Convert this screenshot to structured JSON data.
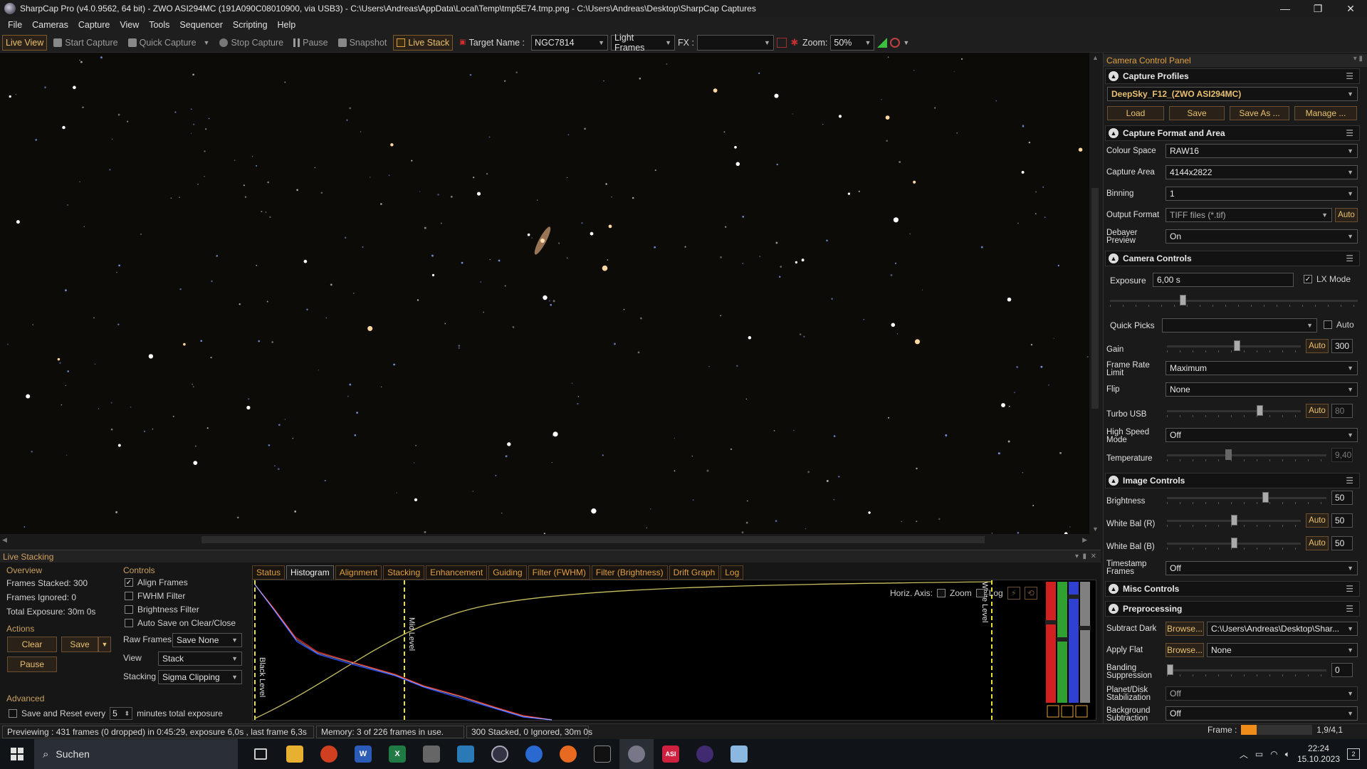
{
  "window": {
    "title": "SharpCap Pro (v4.0.9562, 64 bit) - ZWO ASI294MC (191A090C08010900, via USB3) - C:\\Users\\Andreas\\AppData\\Local\\Temp\\tmp5E74.tmp.png - C:\\Users\\Andreas\\Desktop\\SharpCap Captures",
    "min": "—",
    "max": "❐",
    "close": "✕"
  },
  "menu": [
    "File",
    "Cameras",
    "Capture",
    "View",
    "Tools",
    "Sequencer",
    "Scripting",
    "Help"
  ],
  "toolbar": {
    "live_view": "Live View",
    "start_capture": "Start Capture",
    "quick_capture": "Quick Capture",
    "stop_capture": "Stop Capture",
    "pause": "Pause",
    "snapshot": "Snapshot",
    "live_stack": "Live Stack",
    "target_label": "Target Name :",
    "target_value": "NGC7814",
    "frame_type": "Light Frames",
    "fx_label": "FX :",
    "fx_value": "",
    "zoom_label": "Zoom:",
    "zoom_value": "50%"
  },
  "live_stacking": {
    "title": "Live Stacking",
    "overview": {
      "label": "Overview",
      "frames_stacked": "Frames Stacked: 300",
      "frames_ignored": "Frames Ignored: 0",
      "total_exposure": "Total Exposure:  30m 0s"
    },
    "actions": {
      "label": "Actions",
      "clear": "Clear",
      "save": "Save",
      "pause": "Pause"
    },
    "advanced": {
      "label": "Advanced",
      "save_reset": "Save and Reset every",
      "minutes_value": "5",
      "minutes_label": "minutes total exposure"
    },
    "controls": {
      "label": "Controls",
      "align_frames": "Align Frames",
      "fwhm_filter": "FWHM Filter",
      "brightness_filter": "Brightness Filter",
      "auto_save": "Auto Save on Clear/Close",
      "raw_frames_label": "Raw Frames",
      "raw_frames_value": "Save None",
      "view_label": "View",
      "view_value": "Stack",
      "stacking_label": "Stacking",
      "stacking_value": "Sigma Clipping"
    },
    "tabs": [
      "Status",
      "Histogram",
      "Alignment",
      "Stacking",
      "Enhancement",
      "Guiding",
      "Filter (FWHM)",
      "Filter (Brightness)",
      "Drift Graph",
      "Log"
    ],
    "active_tab": "Histogram",
    "histogram": {
      "horiz_axis": "Horiz. Axis:",
      "zoom": "Zoom",
      "log": "Log",
      "black_level": "Black Level",
      "mid_level": "Mid Level",
      "white_level": "White Level"
    }
  },
  "status_bar": {
    "previewing": "Previewing : 431 frames (0 dropped) in 0:45:29, exposure 6,0s , last frame 6,3s",
    "memory": "Memory: 3 of 226 frames in use.",
    "stacked": "300 Stacked, 0 Ignored, 30m 0s",
    "frame_label": "Frame :",
    "frame_value": "1,9/4,1",
    "frame_fill_fraction": 0.22
  },
  "panel": {
    "title": "Camera Control Panel",
    "capture_profiles": {
      "header": "Capture Profiles",
      "profile": "DeepSky_F12_(ZWO ASI294MC)",
      "load": "Load",
      "save": "Save",
      "save_as": "Save As ...",
      "manage": "Manage ..."
    },
    "format": {
      "header": "Capture Format and Area",
      "colour_space_label": "Colour Space",
      "colour_space": "RAW16",
      "capture_area_label": "Capture Area",
      "capture_area": "4144x2822",
      "binning_label": "Binning",
      "binning": "1",
      "output_format_label": "Output Format",
      "output_format": "TIFF files (*.tif)",
      "auto": "Auto",
      "debayer_label_1": "Debayer",
      "debayer_label_2": "Preview",
      "debayer": "On"
    },
    "camera": {
      "header": "Camera Controls",
      "exposure_label": "Exposure",
      "exposure": "6,00 s",
      "lx_mode": "LX Mode",
      "quick_picks_label": "Quick Picks",
      "quick_picks": "",
      "auto": "Auto",
      "gain_label": "Gain",
      "gain": "300",
      "frame_rate_label_1": "Frame Rate",
      "frame_rate_label_2": "Limit",
      "frame_rate": "Maximum",
      "flip_label": "Flip",
      "flip": "None",
      "turbo_label": "Turbo USB",
      "turbo": "80",
      "high_speed_label_1": "High Speed",
      "high_speed_label_2": "Mode",
      "high_speed": "Off",
      "temperature_label": "Temperature",
      "temperature": "9,40"
    },
    "image": {
      "header": "Image Controls",
      "brightness_label": "Brightness",
      "brightness": "50",
      "wb_r_label": "White Bal (R)",
      "wb_r": "50",
      "wb_b_label": "White Bal (B)",
      "wb_b": "50",
      "auto": "Auto",
      "timestamp_label_1": "Timestamp",
      "timestamp_label_2": "Frames",
      "timestamp": "Off"
    },
    "misc": {
      "header": "Misc Controls"
    },
    "preprocessing": {
      "header": "Preprocessing",
      "subtract_dark_label": "Subtract Dark",
      "browse": "Browse...",
      "dark_path": "C:\\Users\\Andreas\\Desktop\\Shar...",
      "apply_flat_label": "Apply Flat",
      "flat": "None",
      "banding_label_1": "Banding",
      "banding_label_2": "Suppression",
      "banding": "0",
      "planet_label_1": "Planet/Disk",
      "planet_label_2": "Stabilization",
      "planet": "Off",
      "background_label_1": "Background",
      "background_label_2": "Subtraction",
      "background": "Off"
    }
  },
  "taskbar": {
    "search": "Suchen",
    "time": "22:24",
    "date": "15.10.2023"
  },
  "colors": {
    "accent_orange": "#e0a040",
    "frame_fill": "#f08c1a",
    "hist_red": "#d02020",
    "hist_blue": "#3050ff",
    "hist_curve": "#c8c060",
    "level_line": "#e8e030"
  }
}
